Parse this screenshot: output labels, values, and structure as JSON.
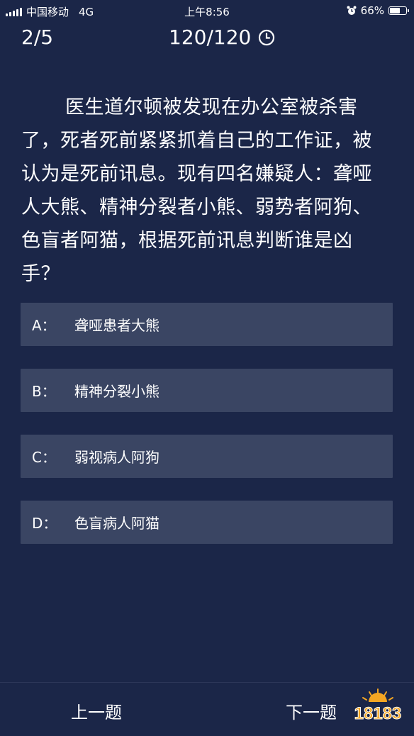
{
  "status_bar": {
    "carrier": "中国移动",
    "network": "4G",
    "time": "上午8:56",
    "battery_percent": "66%",
    "battery_level": 0.66
  },
  "header": {
    "progress": "2/5",
    "timer": "120/120"
  },
  "question": {
    "text": "医生道尔顿被发现在办公室被杀害了，死者死前紧紧抓着自己的工作证，被认为是死前讯息。现有四名嫌疑人：聋哑人大熊、精神分裂者小熊、弱势者阿狗、色盲者阿猫，根据死前讯息判断谁是凶手？"
  },
  "options": [
    {
      "letter": "A：",
      "text": "聋哑患者大熊"
    },
    {
      "letter": "B：",
      "text": "精神分裂小熊"
    },
    {
      "letter": "C：",
      "text": "弱视病人阿狗"
    },
    {
      "letter": "D：",
      "text": "色盲病人阿猫"
    }
  ],
  "footer": {
    "prev_label": "上一题",
    "next_label": "下一题"
  },
  "watermark": {
    "text": "18183"
  }
}
